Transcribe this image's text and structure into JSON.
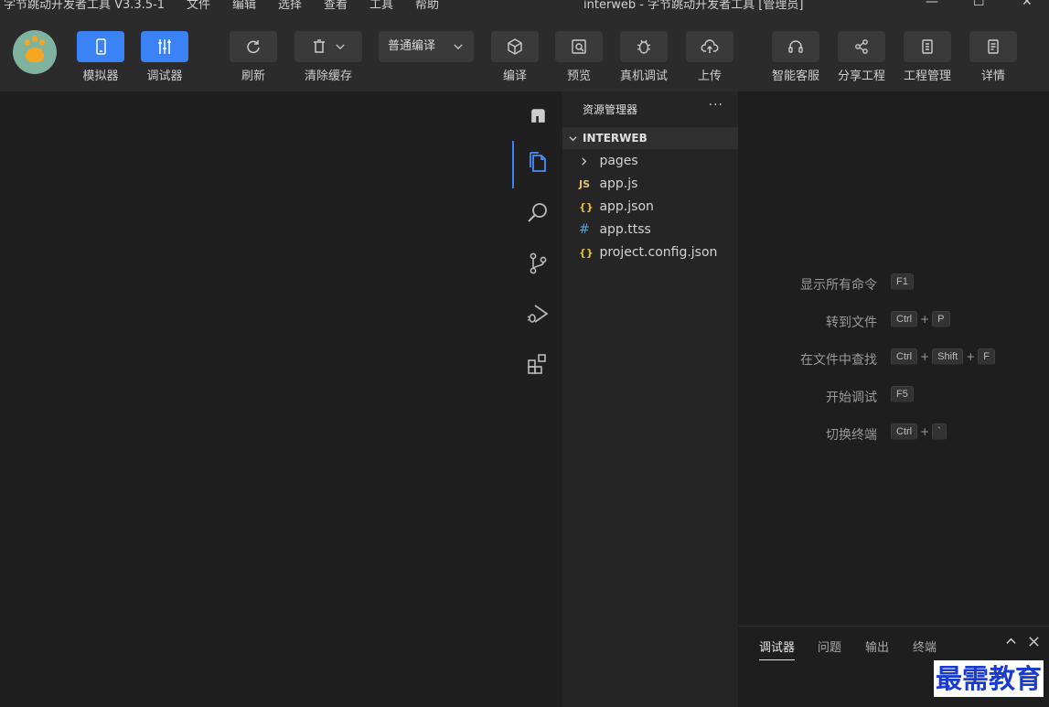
{
  "titlebar": {
    "app_title": "字节跳动开发者工具 V3.3.5-1",
    "menu": [
      "文件",
      "编辑",
      "选择",
      "查看",
      "工具",
      "帮助"
    ],
    "window_title": "interweb - 字节跳动开发者工具 [管理员]",
    "minimize": "—",
    "maximize": "☐",
    "close": "✕"
  },
  "toolbar": {
    "simulator": "模拟器",
    "debugger": "调试器",
    "refresh": "刷新",
    "clear_cache": "清除缓存",
    "compile_mode": "普通编译",
    "compile": "编译",
    "preview": "预览",
    "real_device_debug": "真机调试",
    "upload": "上传",
    "smart_service": "智能客服",
    "share_project": "分享工程",
    "project_manage": "工程管理",
    "details": "详情"
  },
  "explorer": {
    "header": "资源管理器",
    "more": "···",
    "root": "INTERWEB",
    "items": [
      {
        "icon": "folder-chevron",
        "glyph": "›",
        "name": "pages"
      },
      {
        "icon": "js-file",
        "glyph": "JS",
        "name": "app.js"
      },
      {
        "icon": "json-file",
        "glyph": "{}",
        "name": "app.json"
      },
      {
        "icon": "css-file",
        "glyph": "#",
        "name": "app.ttss"
      },
      {
        "icon": "json-file",
        "glyph": "{}",
        "name": "project.config.json"
      }
    ]
  },
  "shortcuts": [
    {
      "label": "显示所有命令",
      "keys": [
        "F1"
      ]
    },
    {
      "label": "转到文件",
      "keys": [
        "Ctrl",
        "P"
      ]
    },
    {
      "label": "在文件中查找",
      "keys": [
        "Ctrl",
        "Shift",
        "F"
      ]
    },
    {
      "label": "开始调试",
      "keys": [
        "F5"
      ]
    },
    {
      "label": "切换终端",
      "keys": [
        "Ctrl",
        "`"
      ]
    }
  ],
  "panel": {
    "tabs": [
      "调试器",
      "问题",
      "输出",
      "终端"
    ],
    "collapse": "^",
    "close": "✕"
  },
  "watermark": "最需教育",
  "colors": {
    "accent": "#3b82f6",
    "background": "#1f1f1f",
    "toolbar": "#2b2b2b"
  }
}
